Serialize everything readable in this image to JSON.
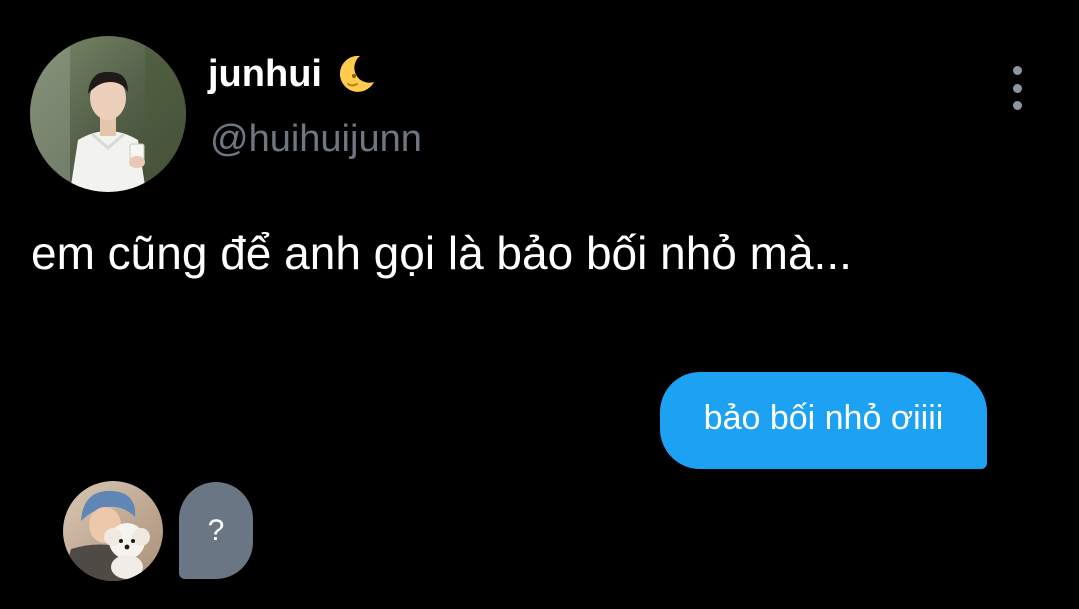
{
  "profile": {
    "avatar_icon": "profile-photo",
    "display_name": "junhui",
    "name_emoji_icon": "crescent-moon-face-icon",
    "handle": "@huihuijunn"
  },
  "menu": {
    "icon": "more-vertical-icon"
  },
  "tweet": {
    "text": "em cũng để anh gọi là bảo bối nhỏ mà..."
  },
  "chat": {
    "sent_message": "bảo bối nhỏ ơiiii",
    "received_avatar_icon": "user-with-puppy-photo",
    "received_message": "?"
  },
  "colors": {
    "background": "#000000",
    "sent_bubble": "#1da1f2",
    "received_bubble": "#6a7684",
    "handle_text": "#6e7681"
  }
}
